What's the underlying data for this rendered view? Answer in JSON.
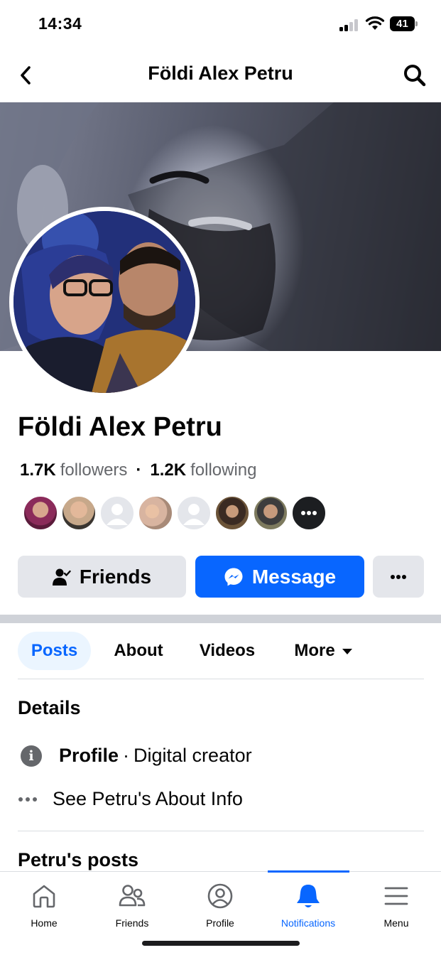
{
  "status_bar": {
    "time": "14:34",
    "battery": "41"
  },
  "header": {
    "title": "Földi Alex Petru"
  },
  "profile": {
    "name": "Földi Alex Petru",
    "followers_count": "1.7K",
    "followers_label": "followers",
    "separator": "·",
    "following_count": "1.2K",
    "following_label": "following"
  },
  "buttons": {
    "friends": "Friends",
    "message": "Message"
  },
  "tabs": [
    {
      "label": "Posts",
      "active": true
    },
    {
      "label": "About"
    },
    {
      "label": "Videos"
    },
    {
      "label": "More"
    }
  ],
  "details": {
    "title": "Details",
    "profile_label": "Profile",
    "profile_separator": "·",
    "profile_value": "Digital creator",
    "about_link": "See Petru's About Info"
  },
  "posts_section": {
    "title": "Petru's posts"
  },
  "bottom_nav": [
    {
      "label": "Home",
      "icon": "home-icon"
    },
    {
      "label": "Friends",
      "icon": "friends-icon"
    },
    {
      "label": "Profile",
      "icon": "profile-icon"
    },
    {
      "label": "Notifications",
      "icon": "bell-icon",
      "active": true
    },
    {
      "label": "Menu",
      "icon": "menu-icon"
    }
  ],
  "colors": {
    "accent": "#0866ff",
    "secondary_button": "#e4e6eb",
    "muted_text": "#65676b",
    "active_tab_bg": "#ebf5ff"
  }
}
